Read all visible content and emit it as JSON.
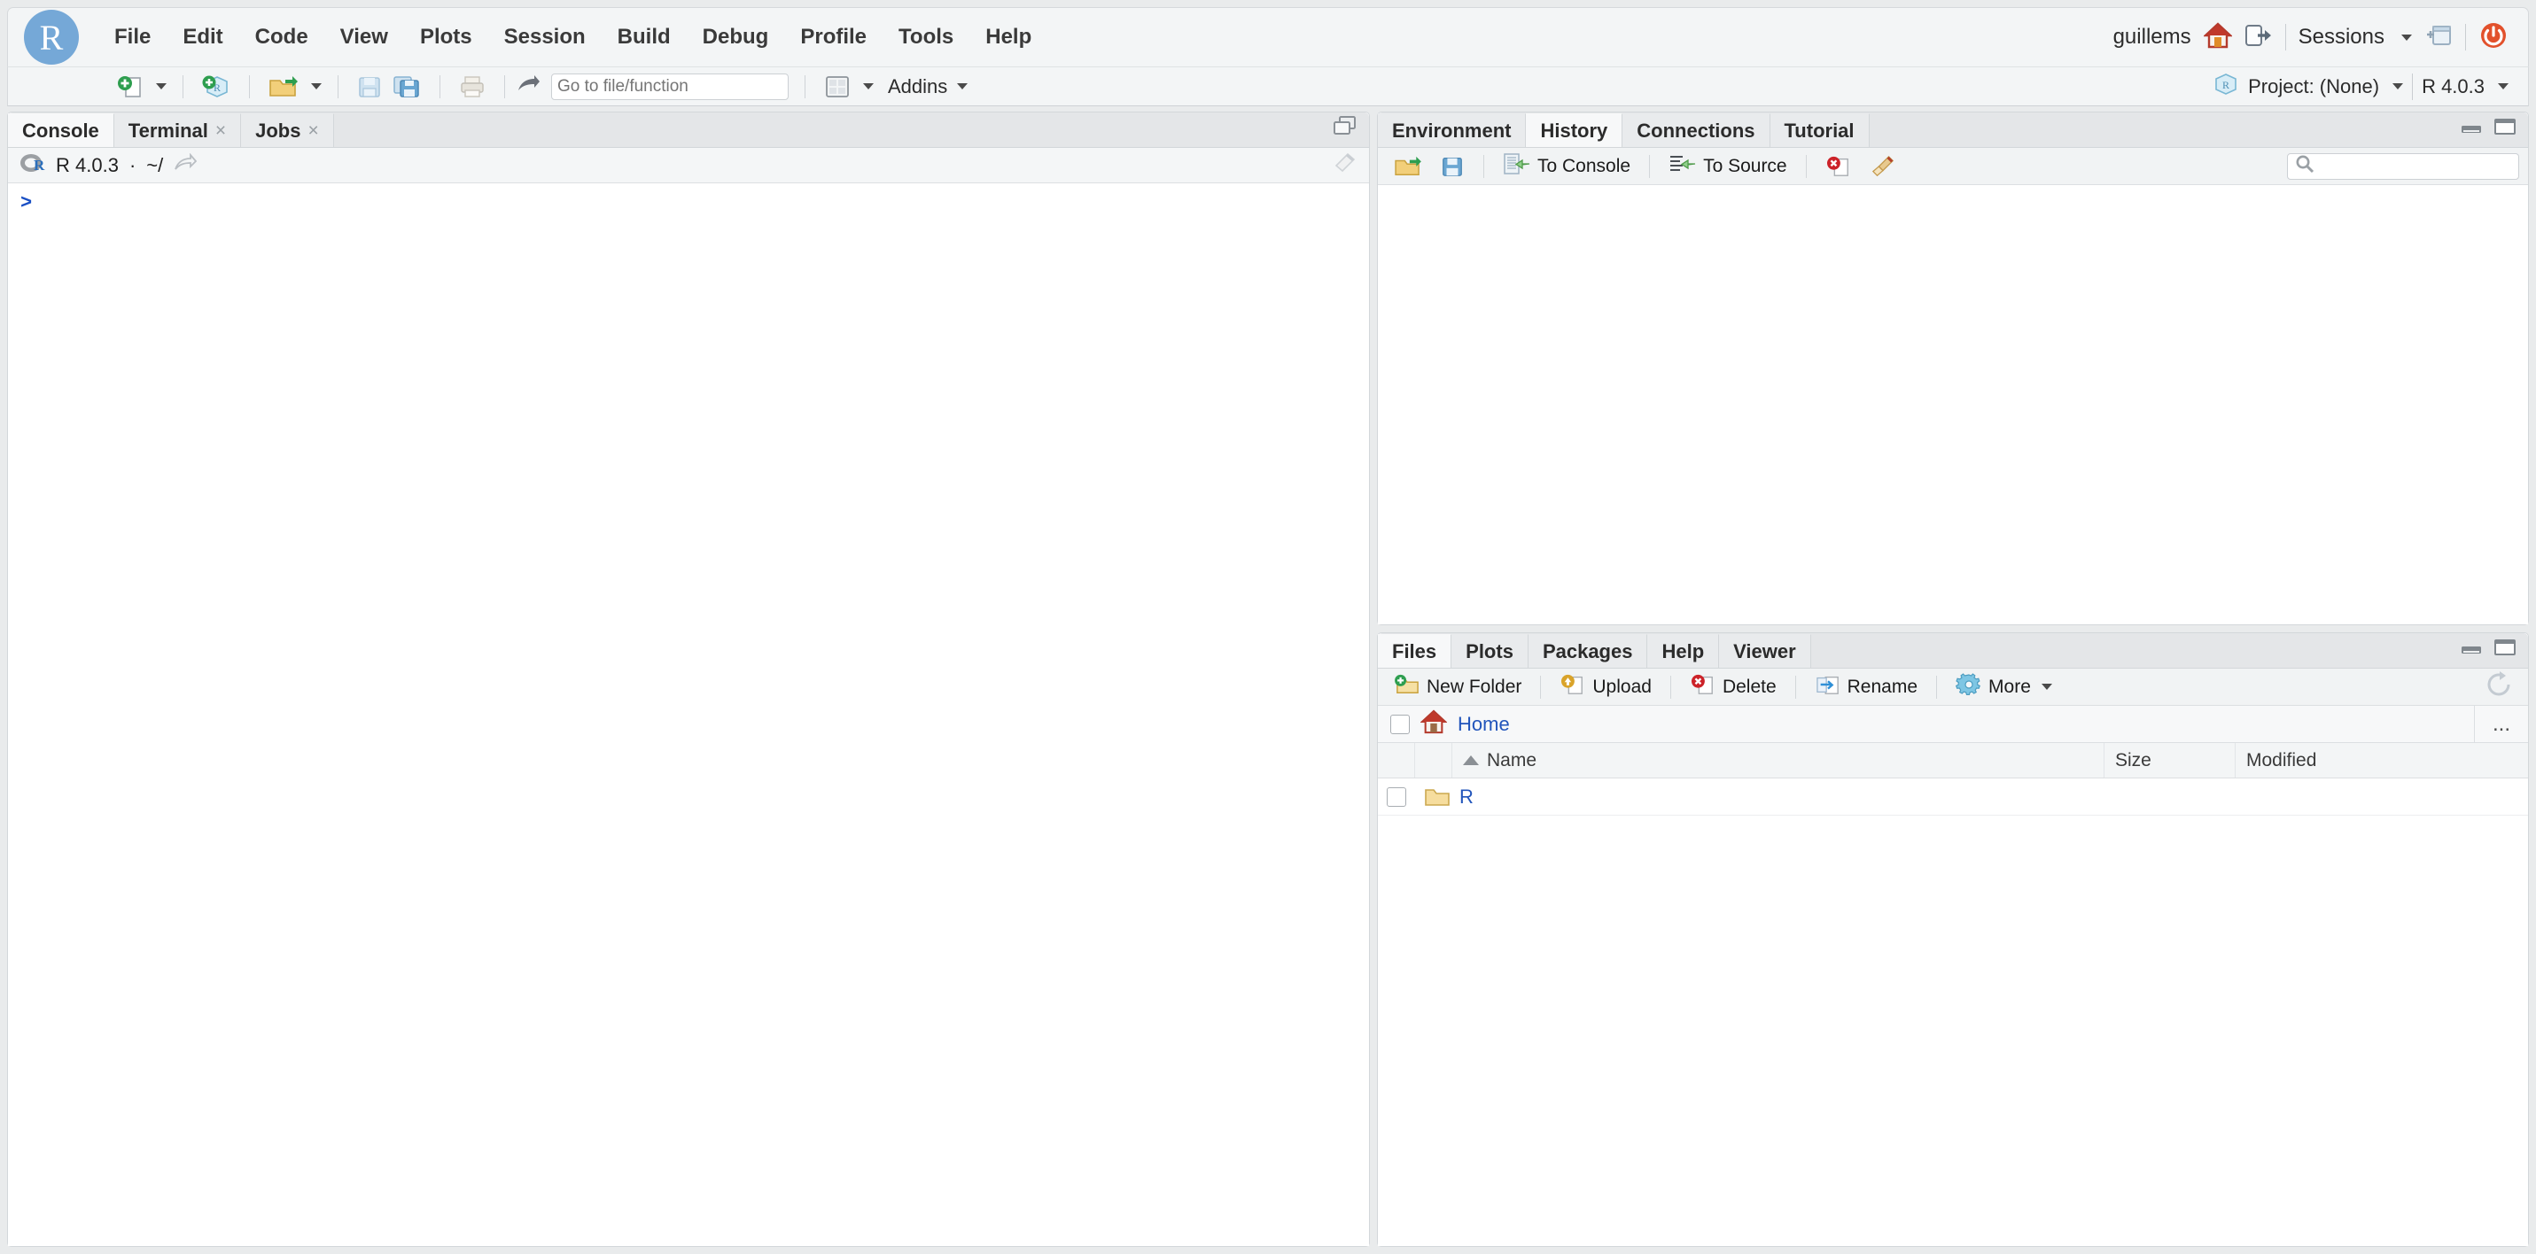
{
  "app": {
    "logo_letter": "R",
    "user": "guillems",
    "sessions_label": "Sessions"
  },
  "menubar": {
    "items": [
      {
        "label": "File"
      },
      {
        "label": "Edit"
      },
      {
        "label": "Code"
      },
      {
        "label": "View"
      },
      {
        "label": "Plots"
      },
      {
        "label": "Session"
      },
      {
        "label": "Build"
      },
      {
        "label": "Debug"
      },
      {
        "label": "Profile"
      },
      {
        "label": "Tools"
      },
      {
        "label": "Help"
      }
    ]
  },
  "toolbar": {
    "new_file_icon": "new-file-icon",
    "new_project_icon": "new-project-icon",
    "open_file_icon": "open-file-icon",
    "save_icon": "save-icon",
    "save_all_icon": "save-all-icon",
    "print_icon": "print-icon",
    "goto_placeholder": "Go to file/function",
    "goto_value": "",
    "panes_icon": "pane-layout-icon",
    "addins_label": "Addins",
    "project_label": "Project: (None)",
    "r_version_label": "R 4.0.3"
  },
  "console_pane": {
    "tabs": [
      {
        "label": "Console",
        "closable": false,
        "active": true
      },
      {
        "label": "Terminal",
        "closable": true,
        "active": false
      },
      {
        "label": "Jobs",
        "closable": true,
        "active": false
      }
    ],
    "close_glyph": "×",
    "version": "R 4.0.3",
    "separator": "·",
    "path": "~/",
    "prompt": ">"
  },
  "env_pane": {
    "tabs": [
      {
        "label": "Environment",
        "active": false
      },
      {
        "label": "History",
        "active": true
      },
      {
        "label": "Connections",
        "active": false
      },
      {
        "label": "Tutorial",
        "active": false
      }
    ],
    "toolbar": {
      "open_label": "",
      "save_label": "",
      "to_console_label": "To Console",
      "to_source_label": "To Source",
      "remove_icon": "remove-icon",
      "clear_icon": "broom-clear-icon"
    },
    "search_placeholder": "",
    "search_value": ""
  },
  "files_pane": {
    "tabs": [
      {
        "label": "Files",
        "active": true
      },
      {
        "label": "Plots",
        "active": false
      },
      {
        "label": "Packages",
        "active": false
      },
      {
        "label": "Help",
        "active": false
      },
      {
        "label": "Viewer",
        "active": false
      }
    ],
    "toolbar": {
      "new_folder_label": "New Folder",
      "upload_label": "Upload",
      "delete_label": "Delete",
      "rename_label": "Rename",
      "more_label": "More",
      "refresh_icon": "refresh-icon"
    },
    "breadcrumb": {
      "home_label": "Home",
      "overflow_label": "..."
    },
    "columns": [
      {
        "label": "Name",
        "sorted": "asc"
      },
      {
        "label": "Size"
      },
      {
        "label": "Modified"
      }
    ],
    "rows": [
      {
        "name": "R",
        "type": "folder",
        "size": "",
        "modified": ""
      }
    ]
  },
  "colors": {
    "accent_blue": "#75a8d7",
    "link_blue": "#2255bb",
    "prompt_blue": "#1a4fc4",
    "power_red": "#e2512c",
    "folder_yellow": "#f2c75c",
    "header_bg": "#f3f5f6"
  }
}
